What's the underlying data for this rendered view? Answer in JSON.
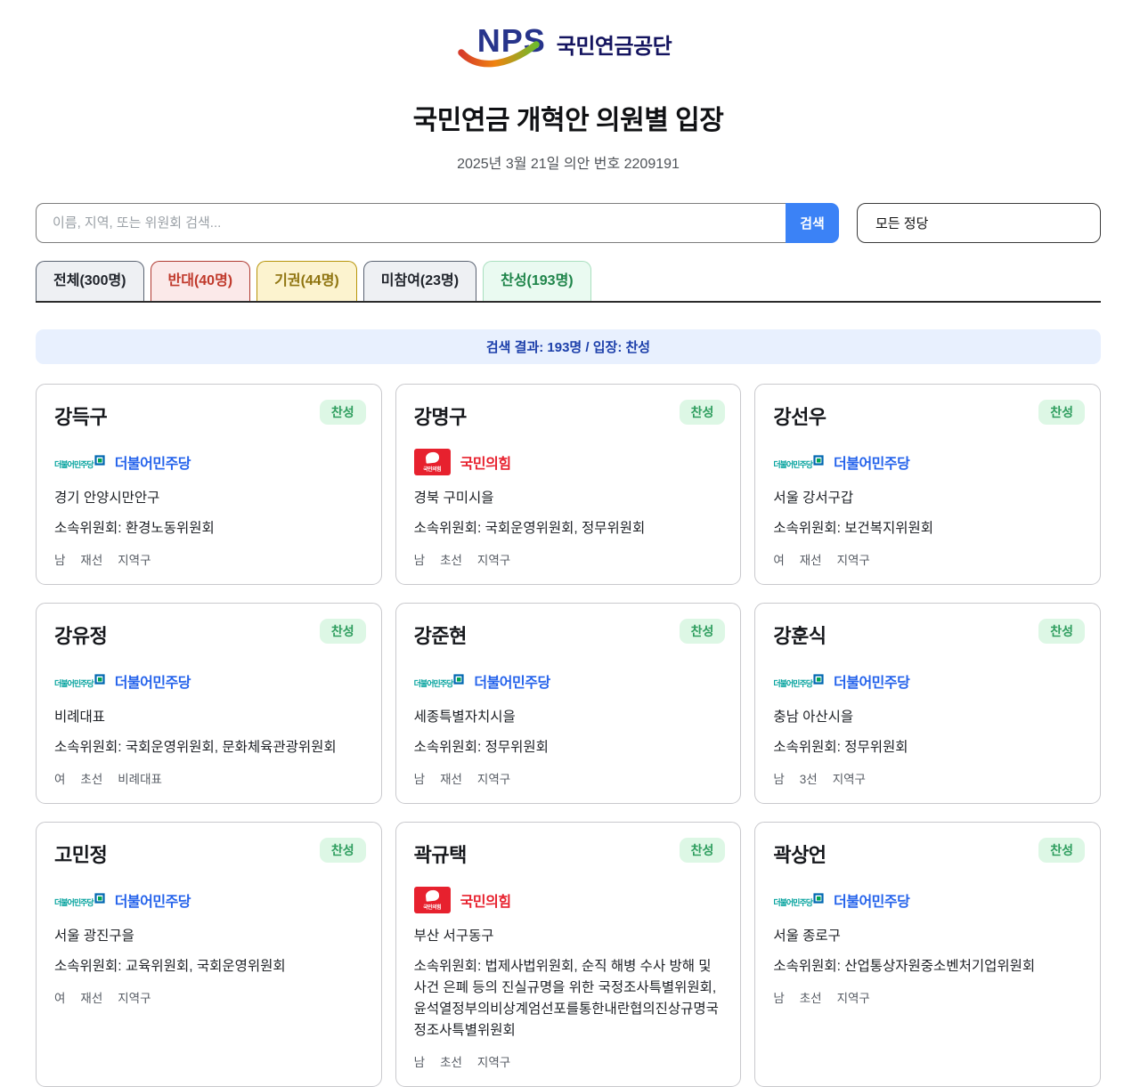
{
  "header": {
    "logo_text": "NPS",
    "logo_org": "국민연금공단",
    "title": "국민연금 개혁안 의원별 입장",
    "subtitle": "2025년 3월 21일 의안 번호 2209191"
  },
  "search": {
    "placeholder": "이름, 지역, 또는 위원회 검색...",
    "button_label": "검색",
    "party_filter_value": "모든 정당"
  },
  "tabs": [
    {
      "label": "전체(300명)",
      "type": "all"
    },
    {
      "label": "반대(40명)",
      "type": "oppose"
    },
    {
      "label": "기권(44명)",
      "type": "abstain"
    },
    {
      "label": "미참여(23명)",
      "type": "absent"
    },
    {
      "label": "찬성(193명)",
      "type": "approve"
    }
  ],
  "result_banner": "검색 결과: 193명 / 입장: 찬성",
  "cards": [
    {
      "name": "강득구",
      "stance": "찬성",
      "party": "더불어민주당",
      "party_class": "dem",
      "district": "경기 안양시만안구",
      "committee": "소속위원회: 환경노동위원회",
      "meta": [
        "남",
        "재선",
        "지역구"
      ]
    },
    {
      "name": "강명구",
      "stance": "찬성",
      "party": "국민의힘",
      "party_class": "ppp",
      "district": "경북 구미시을",
      "committee": "소속위원회: 국회운영위원회, 정무위원회",
      "meta": [
        "남",
        "초선",
        "지역구"
      ]
    },
    {
      "name": "강선우",
      "stance": "찬성",
      "party": "더불어민주당",
      "party_class": "dem",
      "district": "서울 강서구갑",
      "committee": "소속위원회: 보건복지위원회",
      "meta": [
        "여",
        "재선",
        "지역구"
      ]
    },
    {
      "name": "강유정",
      "stance": "찬성",
      "party": "더불어민주당",
      "party_class": "dem",
      "district": "비례대표",
      "committee": "소속위원회: 국회운영위원회, 문화체육관광위원회",
      "meta": [
        "여",
        "초선",
        "비례대표"
      ]
    },
    {
      "name": "강준현",
      "stance": "찬성",
      "party": "더불어민주당",
      "party_class": "dem",
      "district": "세종특별자치시을",
      "committee": "소속위원회: 정무위원회",
      "meta": [
        "남",
        "재선",
        "지역구"
      ]
    },
    {
      "name": "강훈식",
      "stance": "찬성",
      "party": "더불어민주당",
      "party_class": "dem",
      "district": "충남 아산시을",
      "committee": "소속위원회: 정무위원회",
      "meta": [
        "남",
        "3선",
        "지역구"
      ]
    },
    {
      "name": "고민정",
      "stance": "찬성",
      "party": "더불어민주당",
      "party_class": "dem",
      "district": "서울 광진구을",
      "committee": "소속위원회: 교육위원회, 국회운영위원회",
      "meta": [
        "여",
        "재선",
        "지역구"
      ]
    },
    {
      "name": "곽규택",
      "stance": "찬성",
      "party": "국민의힘",
      "party_class": "ppp",
      "district": "부산 서구동구",
      "committee": "소속위원회: 법제사법위원회, 순직 해병 수사 방해 및 사건 은폐 등의 진실규명을 위한 국정조사특별위원회, 윤석열정부의비상계엄선포를통한내란협의진상규명국정조사특별위원회",
      "meta": [
        "남",
        "초선",
        "지역구"
      ]
    },
    {
      "name": "곽상언",
      "stance": "찬성",
      "party": "더불어민주당",
      "party_class": "dem",
      "district": "서울 종로구",
      "committee": "소속위원회: 산업통상자원중소벤처기업위원회",
      "meta": [
        "남",
        "초선",
        "지역구"
      ]
    }
  ],
  "colors": {
    "accent_blue": "#3b82f6",
    "banner_blue": "#1c3faa",
    "approve_green": "#1e8449",
    "oppose_red": "#c0392b",
    "abstain_yellow": "#b7950b",
    "dem_blue": "#2563eb",
    "ppp_red": "#e7212e",
    "stance_badge_bg": "#ddf7e5",
    "banner_bg": "#e8f0fe"
  }
}
